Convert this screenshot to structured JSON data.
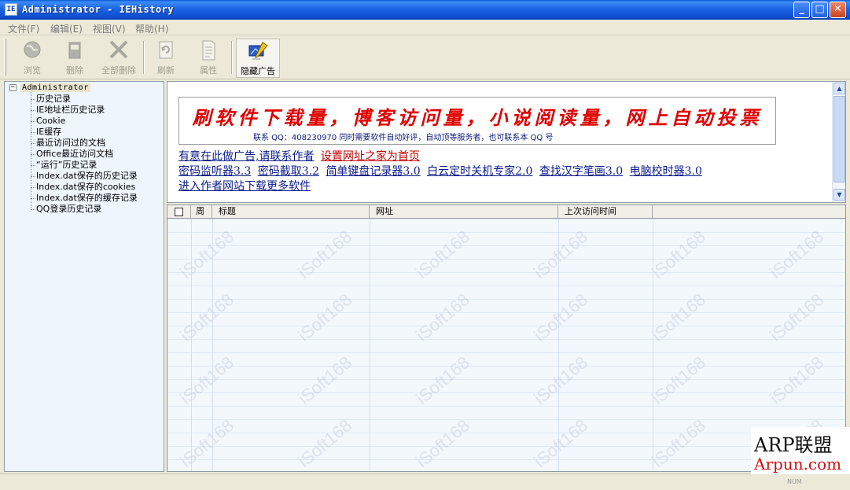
{
  "window": {
    "title": "Administrator - IEHistory",
    "icon_text": "IE",
    "icon": "app-ie-icon",
    "buttons": [
      "minimize-icon",
      "maximize-icon",
      "close-icon"
    ]
  },
  "menu": [
    {
      "label": "文件(F)"
    },
    {
      "label": "编辑(E)"
    },
    {
      "label": "视图(V)"
    },
    {
      "label": "帮助(H)"
    }
  ],
  "toolbar": [
    {
      "label": "浏览",
      "icon": "globe-icon",
      "enabled": false
    },
    {
      "label": "删除",
      "icon": "trash-icon",
      "enabled": false
    },
    {
      "label": "全部删除",
      "icon": "delete-all-icon",
      "enabled": false
    },
    {
      "label": "刷新",
      "icon": "refresh-icon",
      "enabled": false
    },
    {
      "label": "属性",
      "icon": "properties-icon",
      "enabled": false
    },
    {
      "label": "隐藏广告",
      "icon": "hide-ads-icon",
      "enabled": true,
      "active": true
    }
  ],
  "tree": {
    "root": "Administrator",
    "expander": "−",
    "items": [
      "历史记录",
      "IE地址栏历史记录",
      "Cookie",
      "IE缓存",
      "最近访问过的文档",
      "Office最近访问文档",
      "“运行”历史记录",
      "Index.dat保存的历史记录",
      "Index.dat保存的cookies",
      "Index.dat保存的缓存记录",
      "QQ登录历史记录"
    ]
  },
  "ad": {
    "banner_main": "刷软件下载量，博客访问量，小说阅读量，网上自动投票",
    "banner_sub": "联系 QQ：408230970  同时需要软件自动好评，自动顶等服务者，也可联系本 QQ 号",
    "links": [
      {
        "label": "有意在此做广告,请联系作者",
        "color": "#0a1a8a"
      },
      {
        "label": "设置网址之家为首页",
        "color": "#c00000"
      },
      {
        "label": "密码监听器3.3",
        "color": "#0a1a8a"
      },
      {
        "label": "密码截取3.2",
        "color": "#0a1a8a"
      },
      {
        "label": "简单键盘记录器3.0",
        "color": "#0a1a8a"
      },
      {
        "label": "白云定时关机专家2.0",
        "color": "#0a1a8a"
      },
      {
        "label": "查找汉字笔画3.0",
        "color": "#0a1a8a"
      },
      {
        "label": "电脑校时器3.0",
        "color": "#0a1a8a"
      },
      {
        "label": "进入作者网站下载更多软件",
        "color": "#0a1a8a"
      }
    ],
    "scroll_up": "▲",
    "scroll_down": "▼"
  },
  "list": {
    "columns": [
      "",
      "周",
      "标题",
      "网址",
      "上次访问时间",
      ""
    ],
    "rows": []
  },
  "watermark_text": "iSoft168",
  "status": {
    "num": "NUM"
  },
  "logo": {
    "top": "ARP联盟",
    "bottom": "Arpun.com"
  }
}
